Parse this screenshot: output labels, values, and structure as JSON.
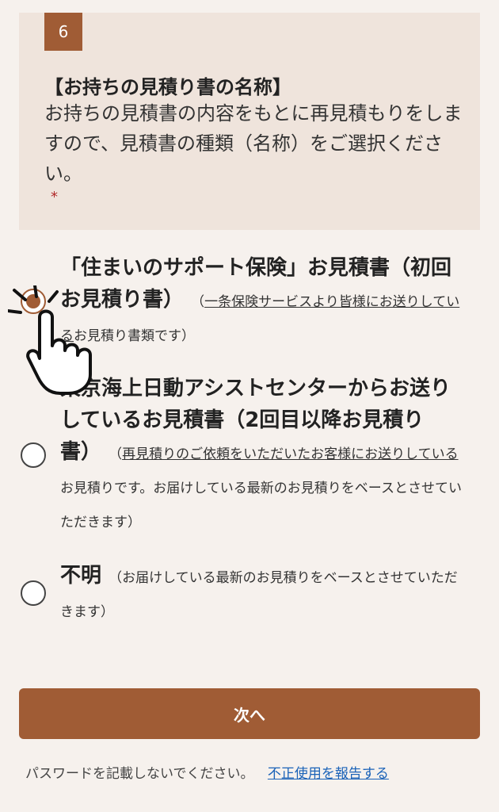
{
  "question": {
    "number": "6",
    "title": "【お持ちの見積り書の名称】",
    "description": "お持ちの見積書の内容をもとに再見積もりをしますので、見積書の種類（名称）をご選択ください。",
    "required_mark": "*"
  },
  "options": [
    {
      "label": "「住まいのサポート保険」お見積書（初回お見積り書）",
      "note_open": "（",
      "note_link": "一条保険サービスより皆様にお送りしている",
      "note_rest": "お見積り書類です）",
      "selected": true
    },
    {
      "label": "東京海上日動アシストセンターからお送りしているお見積書（2回目以降お見積り書）",
      "note_open": "（",
      "note_link": "再見積りのご依頼をいただいたお客様にお送りしている",
      "note_rest": "お見積りです。お届けしている最新のお見積りをベースとさせていただきます）",
      "selected": false
    },
    {
      "label": "不明",
      "note_open": "",
      "note_link": "",
      "note_rest": "（お届けしている最新のお見積りをベースとさせていただきます）",
      "selected": false
    }
  ],
  "next_button": {
    "label": "次へ"
  },
  "footer": {
    "notice": "パスワードを記載しないでください。",
    "report_link": "不正使用を報告する"
  },
  "colors": {
    "accent": "#a05c35",
    "card_bg": "#efe4dc",
    "page_bg": "#f6f1ed",
    "link": "#1a62b8"
  }
}
